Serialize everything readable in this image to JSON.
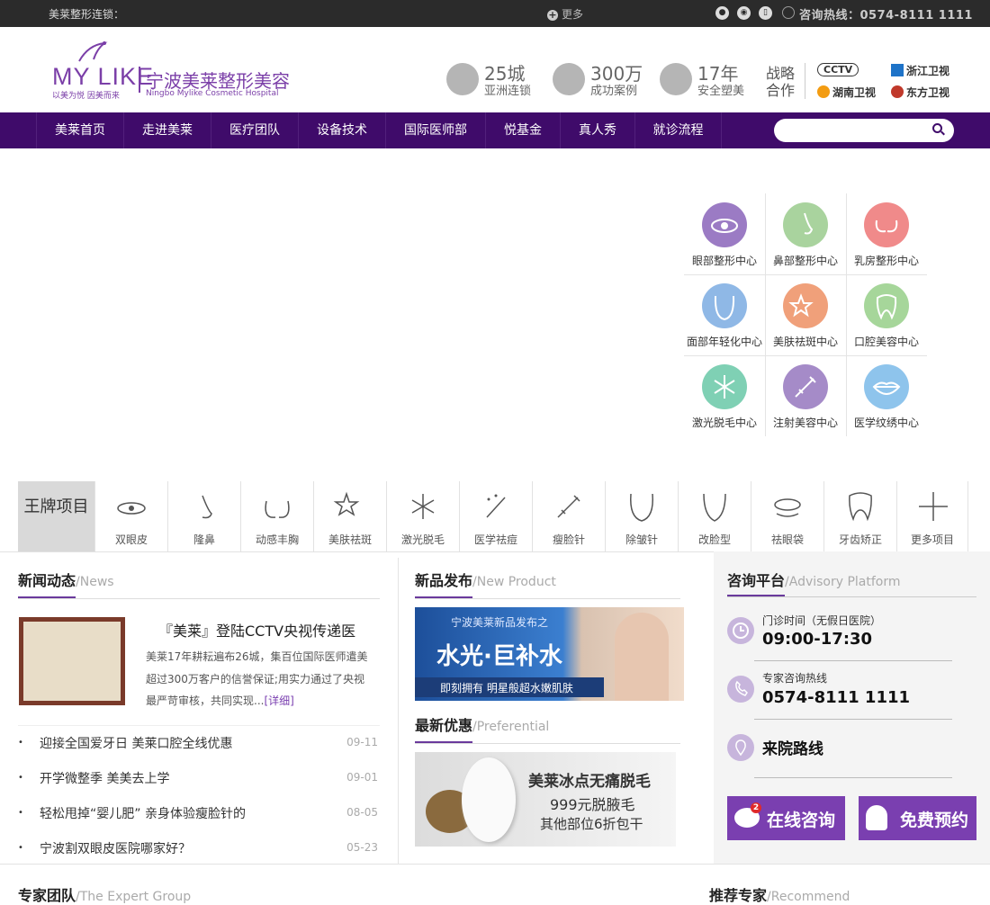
{
  "topbar": {
    "chain_label": "美莱整形连锁：",
    "more": "更多",
    "hotline": "咨询热线：0574-8111 1111",
    "social_icons": [
      "wechat-icon",
      "weibo-icon",
      "phone-icon"
    ]
  },
  "header": {
    "logo_en": "MY LIKE",
    "logo_cn": "宁波美莱整形美容",
    "logo_slogan": "以美为悦  因美而来",
    "logo_hospital": "Ningbo Mylike Cosmetic Hospital",
    "stats": [
      {
        "big": "25城",
        "small": "亚洲连锁",
        "icon": "globe-icon"
      },
      {
        "big": "300万",
        "small": "成功案例",
        "icon": "diamond-icon"
      },
      {
        "big": "17年",
        "small": "安全塑美",
        "icon": "trophy-icon"
      }
    ],
    "strategic": "战略合作",
    "media": [
      "CCTV",
      "浙江卫视",
      "湖南卫视",
      "东方卫视"
    ]
  },
  "nav": {
    "items": [
      "美莱首页",
      "走进美莱",
      "医疗团队",
      "设备技术",
      "国际医师部",
      "悦基金",
      "真人秀",
      "就诊流程"
    ],
    "search_placeholder": ""
  },
  "centers": [
    {
      "label": "眼部整形中心",
      "color": "#9b7bc4",
      "icon": "eye-icon"
    },
    {
      "label": "鼻部整形中心",
      "color": "#a9d39e",
      "icon": "nose-icon"
    },
    {
      "label": "乳房整形中心",
      "color": "#f08a8a",
      "icon": "breast-icon"
    },
    {
      "label": "面部年轻化中心",
      "color": "#8fb8e6",
      "icon": "face-icon"
    },
    {
      "label": "美肤祛斑中心",
      "color": "#f0a07a",
      "icon": "sparkle-icon"
    },
    {
      "label": "口腔美容中心",
      "color": "#a6d69a",
      "icon": "tooth-icon"
    },
    {
      "label": "激光脱毛中心",
      "color": "#7fd0b4",
      "icon": "snowflake-icon"
    },
    {
      "label": "注射美容中心",
      "color": "#a58bc8",
      "icon": "syringe-icon"
    },
    {
      "label": "医学纹绣中心",
      "color": "#8ec4ec",
      "icon": "lips-icon"
    }
  ],
  "projects": {
    "king_label": "王牌项目",
    "items": [
      {
        "label": "双眼皮",
        "icon": "eye-icon"
      },
      {
        "label": "隆鼻",
        "icon": "nose-icon"
      },
      {
        "label": "动感丰胸",
        "icon": "breast-icon"
      },
      {
        "label": "美肤祛斑",
        "icon": "star-icon"
      },
      {
        "label": "激光脱毛",
        "icon": "snowflake-icon"
      },
      {
        "label": "医学祛痘",
        "icon": "wand-icon"
      },
      {
        "label": "瘦脸针",
        "icon": "syringe-icon"
      },
      {
        "label": "除皱针",
        "icon": "wrinkle-face-icon"
      },
      {
        "label": "改脸型",
        "icon": "face-outline-icon"
      },
      {
        "label": "祛眼袋",
        "icon": "eyebag-icon"
      },
      {
        "label": "牙齿矫正",
        "icon": "tooth-icon"
      },
      {
        "label": "更多项目",
        "icon": "plus-icon"
      }
    ]
  },
  "news": {
    "title": "新闻动态",
    "en": "/News",
    "headline": "『美莱』登陆CCTV央视传递医",
    "summary_lines": [
      "美莱17年耕耘遍布26城，集百位国际医师遣美",
      "超过300万客户的信誉保证;用实力通过了央视",
      "最严苛审核，共同实现..."
    ],
    "detail": "[详细]",
    "items": [
      {
        "text": "迎接全国爱牙日 美莱口腔全线优惠",
        "date": "09-11"
      },
      {
        "text": "开学微整季  美美去上学",
        "date": "09-01"
      },
      {
        "text": "轻松甩掉“婴儿肥” 亲身体验瘦脸针的",
        "date": "08-05"
      },
      {
        "text": "宁波割双眼皮医院哪家好？",
        "date": "05-23"
      }
    ]
  },
  "product": {
    "title": "新品发布",
    "en": "/New Product",
    "banner_top": "宁波美莱新品发布之",
    "banner_main": "水光·巨补水",
    "banner_sub": "即刻拥有 明星般超水嫩肌肤"
  },
  "offer": {
    "title": "最新优惠",
    "en": "/Preferential",
    "line1": "美莱冰点无痛脱毛",
    "line2": "999元脱腋毛",
    "line3": "其他部位6折包干"
  },
  "advisory": {
    "title": "咨询平台",
    "en": "/Advisory Platform",
    "hours_label": "门诊时间（无假日医院）",
    "hours": "09:00-17:30",
    "phone_label": "专家咨询热线",
    "phone": "0574-8111 1111",
    "route": "来院路线",
    "online": "在线咨询",
    "appoint": "免费预约",
    "badge": "2"
  },
  "bottom": {
    "expert": "专家团队",
    "expert_en": "/The Expert Group",
    "recommend": "推荐专家",
    "recommend_en": "/Recommend"
  }
}
